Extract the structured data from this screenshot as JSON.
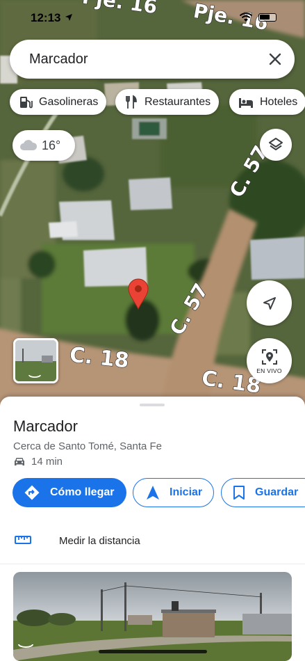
{
  "status_bar": {
    "time": "12:13"
  },
  "search": {
    "query": "Marcador"
  },
  "chips": [
    {
      "label": "Gasolineras",
      "icon": "gas-station-icon"
    },
    {
      "label": "Restaurantes",
      "icon": "restaurant-icon"
    },
    {
      "label": "Hoteles",
      "icon": "hotel-icon"
    }
  ],
  "weather": {
    "temperature": "16°",
    "icon": "cloud-icon"
  },
  "map": {
    "road_labels": [
      "Pje. 16",
      "Pje. 16",
      "C. 57",
      "C. 57",
      "C. 18",
      "C. 18"
    ],
    "live_view_label": "EN VIVO"
  },
  "place": {
    "title": "Marcador",
    "subtitle": "Cerca de Santo Tomé, Santa Fe",
    "drive_time": "14 min"
  },
  "actions": {
    "directions_label": "Cómo llegar",
    "start_label": "Iniciar",
    "save_label": "Guardar"
  },
  "measure": {
    "label": "Medir la distancia"
  },
  "colors": {
    "accent": "#1a73e8",
    "pin": "#ea4335",
    "text": "#202124",
    "secondary_text": "#5f6368"
  }
}
